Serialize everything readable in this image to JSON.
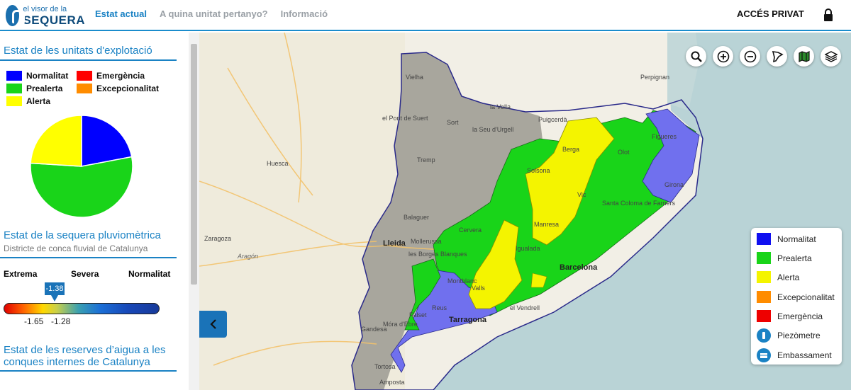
{
  "header": {
    "logo_small": "el visor de la",
    "logo_big": "SEQUERA",
    "nav": [
      "Estat actual",
      "A quina unitat pertanyo?",
      "Informació"
    ],
    "private": "ACCÉS PRIVAT"
  },
  "sidebar": {
    "section1": {
      "title": "Estat de les unitats d'explotació",
      "legend": [
        {
          "label": "Normalitat",
          "color": "#0000ff"
        },
        {
          "label": "Emergència",
          "color": "#ff0000"
        },
        {
          "label": "Prealerta",
          "color": "#19d419"
        },
        {
          "label": "Excepcionalitat",
          "color": "#ff8c00"
        },
        {
          "label": "Alerta",
          "color": "#ffff00"
        }
      ]
    },
    "section2": {
      "title": "Estat de la sequera pluviomètrica",
      "subtitle": "Districte de conca fluvial de Catalunya",
      "scale": {
        "left": "Extrema",
        "middle": "Severa",
        "right": "Normalitat"
      },
      "marker_value": "-1.38",
      "ticks": [
        "-1.65",
        "-1.28"
      ]
    },
    "section3": {
      "title_line1": "Estat de les reserves d’aigua a les",
      "title_line2": "conques internes de Catalunya"
    }
  },
  "chart_data": {
    "type": "pie",
    "slices": [
      {
        "label": "Normalitat",
        "value": 22,
        "color": "#0000ff"
      },
      {
        "label": "Prealerta",
        "value": 54,
        "color": "#19d419"
      },
      {
        "label": "Alerta",
        "value": 24,
        "color": "#ffff00"
      }
    ]
  },
  "map": {
    "labels": [
      "Vielha",
      "el Pont de Suert",
      "Sort",
      "la Seu d'Urgell",
      "Puigcerdà",
      "la Vella",
      "Perpignan",
      "Huesca",
      "Tremp",
      "Balaguer",
      "Lleida",
      "Mollerussa",
      "Cervera",
      "les Borges Blanques",
      "Zaragoza",
      "Aragón",
      "Barcelona",
      "Tarragona",
      "Gandesa",
      "Móra d'Ebre",
      "Falset",
      "Tortosa",
      "Amposta",
      "el Vendrell",
      "Valls",
      "Montblanc",
      "Figueres",
      "Girona",
      "Olot",
      "Vic",
      "Manresa",
      "Igualada",
      "Santa Coloma de Farners",
      "Solsona",
      "Berga",
      "Reus"
    ],
    "legend": [
      {
        "label": "Normalitat",
        "color": "#1010f0"
      },
      {
        "label": "Prealerta",
        "color": "#19d419"
      },
      {
        "label": "Alerta",
        "color": "#f4f400"
      },
      {
        "label": "Excepcionalitat",
        "color": "#ff8c00"
      },
      {
        "label": "Emergència",
        "color": "#ee0000"
      },
      {
        "label": "Piezòmetre",
        "icon": "piezometer-icon"
      },
      {
        "label": "Embassament",
        "icon": "reservoir-icon"
      }
    ]
  }
}
